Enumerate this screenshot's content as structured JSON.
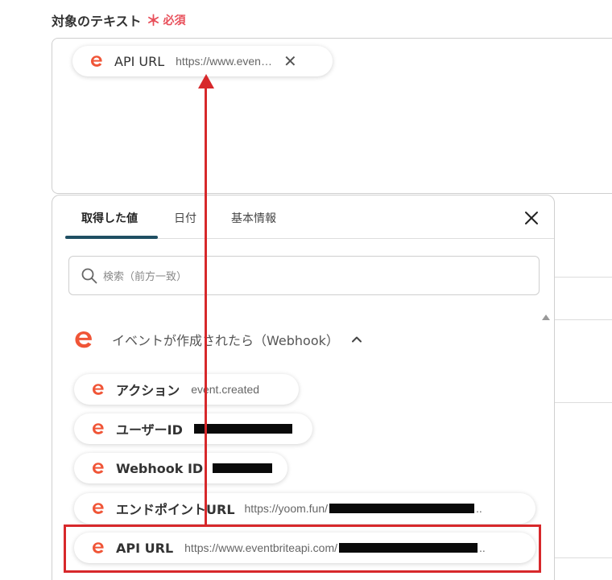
{
  "field": {
    "label": "対象のテキスト",
    "required_mark": "＊",
    "required_text": "必須"
  },
  "selected_chip": {
    "label": "API URL",
    "value": "https://www.even…",
    "close": "✕"
  },
  "panel": {
    "tabs": [
      {
        "label": "取得した値",
        "active": true
      },
      {
        "label": "日付",
        "active": false
      },
      {
        "label": "基本情報",
        "active": false
      }
    ],
    "search_placeholder": "検索（前方一致）",
    "section_title": "イベントが作成されたら（Webhook）",
    "items": [
      {
        "label": "アクション",
        "value": "event.created"
      },
      {
        "label": "ユーザーID",
        "value": ""
      },
      {
        "label": "Webhook ID",
        "value": ""
      },
      {
        "label": "エンドポイントURL",
        "value": "https://yoom.fun/"
      },
      {
        "label": "API URL",
        "value": "https://www.eventbriteapi.com/",
        "value_suffix": ".."
      }
    ]
  },
  "colors": {
    "eventbrite_orange": "#f05537",
    "required_red": "#e8505b",
    "annotation_red": "#d7282b",
    "tab_underline": "#1f4f63"
  },
  "icons": {
    "chip_icon": "eventbrite-e-icon",
    "search": "search-icon",
    "close": "close-icon",
    "chevron": "chevron-up-icon"
  }
}
